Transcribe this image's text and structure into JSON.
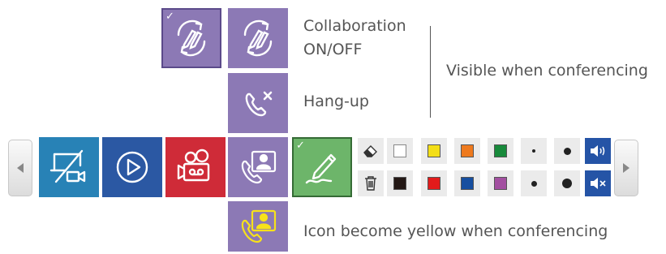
{
  "labels": {
    "collaboration_line1": "Collaboration",
    "collaboration_line2": "ON/OFF",
    "hangup": "Hang-up",
    "visible": "Visible when conferencing",
    "yellow_note": "Icon become yellow when conferencing"
  },
  "toolbar": {
    "buttons": [
      {
        "name": "screen-off",
        "icon": "screen-off-camera-icon",
        "color": "#2882b6"
      },
      {
        "name": "play",
        "icon": "play-circle-icon",
        "color": "#2b58a3"
      },
      {
        "name": "record",
        "icon": "record-camera-icon",
        "color": "#cf2b38"
      },
      {
        "name": "conference",
        "icon": "phone-contact-icon",
        "color": "#8c79b5"
      },
      {
        "name": "pen",
        "icon": "pen-icon",
        "color": "#6db56a",
        "checked": true
      }
    ],
    "tools_top": [
      "eraser-icon",
      "white",
      "yellow",
      "orange",
      "green",
      "dot-small",
      "dot-medium",
      "volume-on-icon"
    ],
    "tools_bottom": [
      "trash-icon",
      "black",
      "red",
      "blue",
      "purple",
      "dot-medium",
      "dot-large",
      "volume-mute-icon"
    ]
  },
  "colors": {
    "white": "#ffffff",
    "yellow": "#f3de17",
    "orange": "#ee7a1e",
    "green": "#188a3b",
    "black": "#231815",
    "red": "#e21b1b",
    "blue": "#174fa0",
    "purple": "#a24fa0",
    "conf_yellow": "#f7e21a",
    "accent_purple": "#8c79b5"
  },
  "status": {
    "collaboration_checked": true,
    "pen_checked": true,
    "check_mark": "✓"
  }
}
